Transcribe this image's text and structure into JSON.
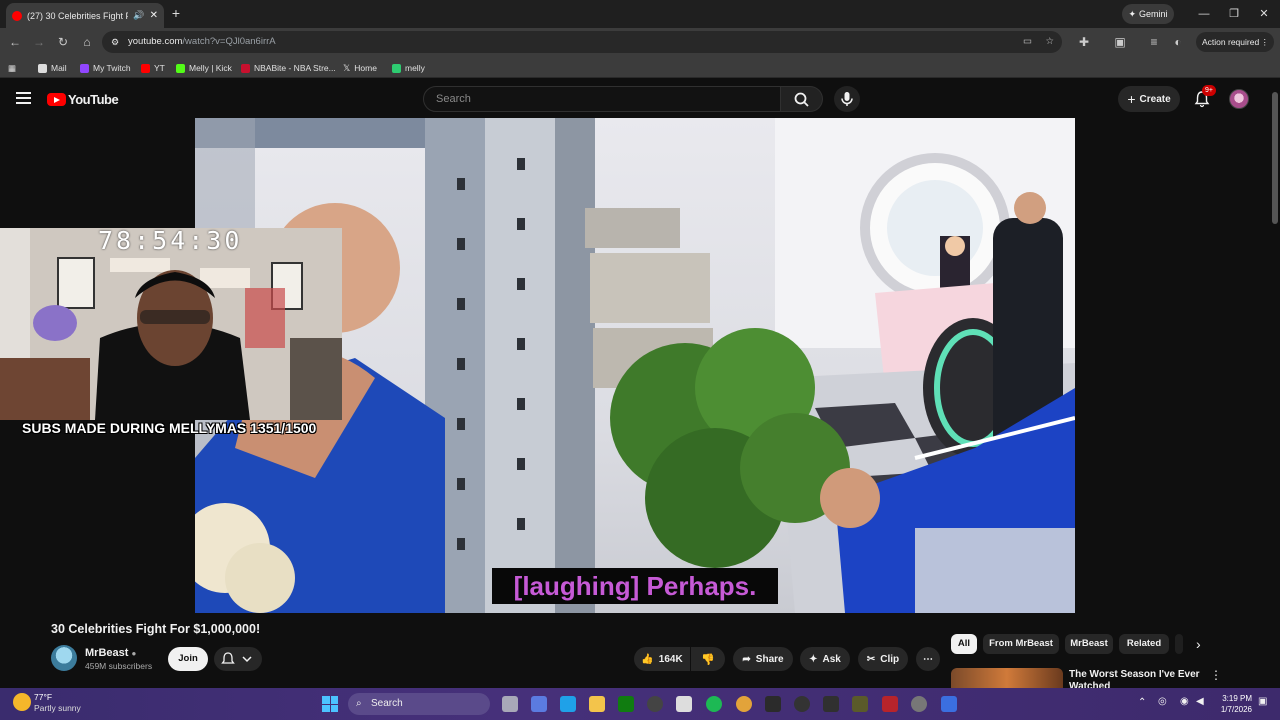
{
  "browser": {
    "tab_title": "(27) 30 Celebrities Fight For",
    "new_tab_label": "+",
    "gemini_label": "Gemini",
    "url_host": "youtube.com",
    "url_path": "/watch?v=QJl0an6irrA",
    "action_label": "Action required",
    "bookmarks": [
      {
        "label": "Mail",
        "color": "#e8e8e8"
      },
      {
        "label": "My Twitch",
        "color": "#9146ff"
      },
      {
        "label": "YT",
        "color": "#ff0000"
      },
      {
        "label": "Melly | Kick",
        "color": "#53fc18"
      },
      {
        "label": "NBABite - NBA Stre...",
        "color": "#c8102e"
      },
      {
        "label": "Home",
        "color": "#ffffff"
      },
      {
        "label": "melly",
        "color": "#2ecc71"
      }
    ]
  },
  "youtube": {
    "logo_text": "YouTube",
    "search_placeholder": "Search",
    "create_label": "Create",
    "notification_badge": "9+"
  },
  "overlay": {
    "timer": "78:54:30",
    "subs_text": "SUBS MADE DURING MELLYMAS 1351/1500"
  },
  "video": {
    "caption": "[laughing] Perhaps.",
    "title": "30 Celebrities Fight For $1,000,000!",
    "channel_name": "MrBeast",
    "channel_subs": "459M subscribers",
    "join_label": "Join",
    "like_count": "164K",
    "share_label": "Share",
    "ask_label": "Ask",
    "clip_label": "Clip"
  },
  "sidebar": {
    "chips": [
      "All",
      "From MrBeast",
      "MrBeast",
      "Related"
    ],
    "rec_title": "The Worst Season I've Ever Watched"
  },
  "taskbar": {
    "temp": "77°F",
    "condition": "Partly sunny",
    "search_label": "Search",
    "time": "3:19 PM",
    "date": "1/7/2026"
  }
}
